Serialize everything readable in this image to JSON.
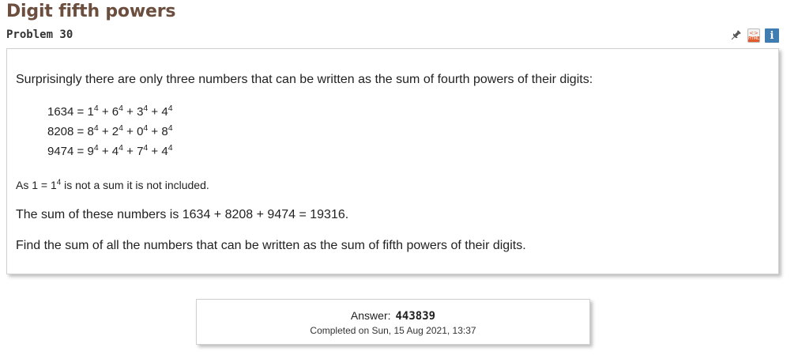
{
  "problem": {
    "title": "Digit fifth powers",
    "number_label": "Problem 30"
  },
  "icons": [
    "pin-icon",
    "html-icon",
    "info-icon"
  ],
  "html_icon_label": "HTML",
  "info_icon_glyph": "i",
  "content": {
    "intro": "Surprisingly there are only three numbers that can be written as the sum of fourth powers of their digits:",
    "equations": [
      {
        "lhs": "1634",
        "digits": [
          "1",
          "6",
          "3",
          "4"
        ]
      },
      {
        "lhs": "8208",
        "digits": [
          "8",
          "2",
          "0",
          "8"
        ]
      },
      {
        "lhs": "9474",
        "digits": [
          "9",
          "4",
          "7",
          "4"
        ]
      }
    ],
    "exponent": "4",
    "note_prefix": "As 1 = 1",
    "note_suffix": " is not a sum it is not included.",
    "sum_text": "The sum of these numbers is 1634 + 8208 + 9474 = 19316.",
    "task": "Find the sum of all the numbers that can be written as the sum of fifth powers of their digits."
  },
  "answer": {
    "label": "Answer:",
    "value": "443839",
    "completed": "Completed on Sun, 15 Aug 2021, 13:37"
  }
}
